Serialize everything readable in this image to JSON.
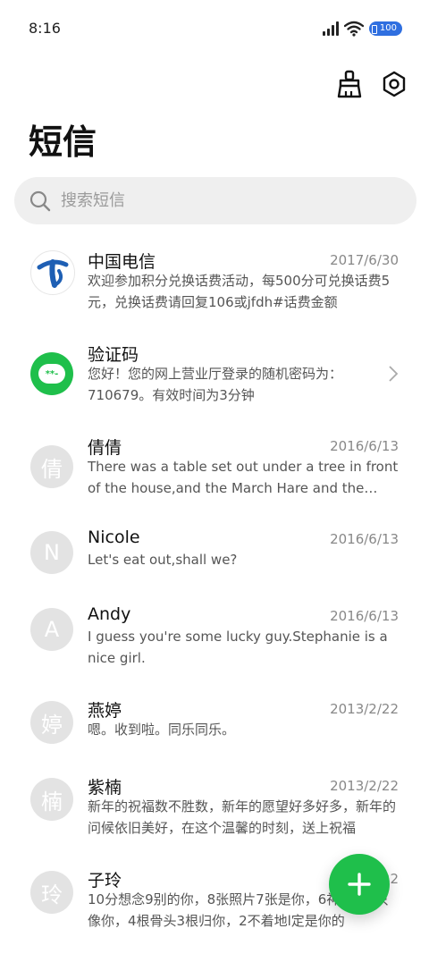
{
  "status_bar": {
    "time": "8:16",
    "battery": "100"
  },
  "header": {
    "title": "短信"
  },
  "search": {
    "placeholder": "搜索短信"
  },
  "conversations": [
    {
      "name": "中国电信",
      "date": "2017/6/30",
      "preview": "欢迎参加积分兑换话费活动，每500分可兑换话费5元，兑换话费请回复106或jfdh#话费金额",
      "avatar_text": "",
      "avatar_type": "telecom-logo"
    },
    {
      "name": "验证码",
      "date": "",
      "preview": "您好！您的网上营业厅登录的随机密码为：710679。有效时间为3分钟",
      "avatar_text": "**-",
      "avatar_type": "code-icon"
    },
    {
      "name": "倩倩",
      "date": "2016/6/13",
      "preview": "There was a table set out under a tree in front of the house,and the March Hare and the Hatter were having tea",
      "avatar_text": "倩",
      "avatar_type": "letter"
    },
    {
      "name": "Nicole",
      "date": "2016/6/13",
      "preview": "Let's eat out,shall we?",
      "avatar_text": "N",
      "avatar_type": "letter"
    },
    {
      "name": "Andy",
      "date": "2016/6/13",
      "preview": "I guess you're some lucky guy.Stephanie is a nice girl.",
      "avatar_text": "A",
      "avatar_type": "letter"
    },
    {
      "name": "燕婷",
      "date": "2013/2/22",
      "preview": "嗯。收到啦。同乐同乐。",
      "avatar_text": "婷",
      "avatar_type": "letter"
    },
    {
      "name": "紫楠",
      "date": "2013/2/22",
      "preview": "新年的祝福数不胜数，新年的愿望好多好多，新年的问候依旧美好，在这个温馨的时刻，送上祝福",
      "avatar_text": "楠",
      "avatar_type": "letter"
    },
    {
      "name": "子玲",
      "date": "2013/2/22",
      "preview": "10分想念9别的你，8张照片7张是你，6神无主5只像你，4根骨头3根归你，2不着地l定是你的",
      "avatar_text": "玲",
      "avatar_type": "letter"
    }
  ],
  "colors": {
    "accent": "#1fbf4b",
    "battery": "#2f6fe0",
    "avatar_bg": "#e3e3e3",
    "telecom_blue": "#1e5fb4"
  },
  "icons": {
    "clean": "broom-icon",
    "settings": "settings-hexagon-icon",
    "search": "search-icon",
    "compose": "plus-icon"
  }
}
